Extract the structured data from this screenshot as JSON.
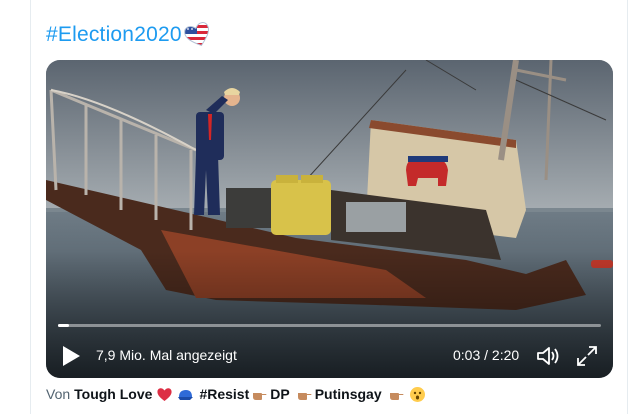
{
  "tweet": {
    "hashtag": "#Election2020",
    "hashtag_emoji": "flag-heart-emoji"
  },
  "video": {
    "views_text": "7,9 Mio. Mal angezeigt",
    "time_text": "0:03 / 2:20",
    "progress": 0.021,
    "play_icon": "play-icon",
    "volume_icon": "volume-icon",
    "fullscreen_icon": "fullscreen-icon"
  },
  "byline": {
    "prefix": "Von",
    "author": "Tough Love",
    "tag_resist": "#Resist",
    "tag_dp": "DP",
    "tag_putins": "Putinsgay",
    "emojis": [
      "red-heart-emoji",
      "blue-cap-emoji",
      "pointing-hand-emoji",
      "pointing-hand-emoji",
      "pointing-hand-emoji",
      "shocked-face-emoji"
    ]
  },
  "colors": {
    "link": "#1d9bf0",
    "text": "#0f1419",
    "muted": "#536471"
  }
}
